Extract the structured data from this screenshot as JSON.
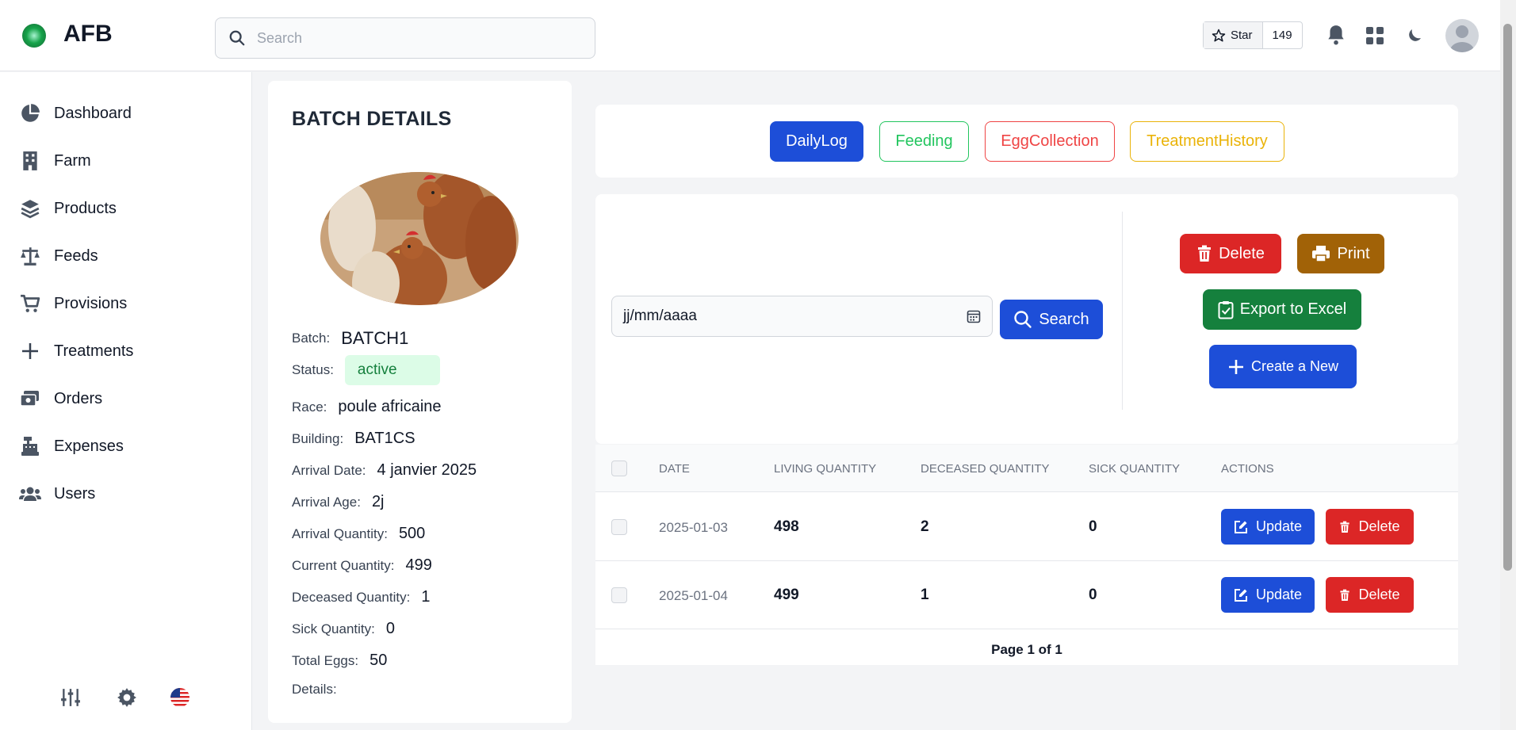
{
  "header": {
    "brand": "AFB",
    "search_placeholder": "Search",
    "star_label": "Star",
    "star_count": "149"
  },
  "sidebar": {
    "items": [
      {
        "label": "Dashboard",
        "icon": "pie-chart-icon"
      },
      {
        "label": "Farm",
        "icon": "building-icon"
      },
      {
        "label": "Products",
        "icon": "layers-icon"
      },
      {
        "label": "Feeds",
        "icon": "scale-icon"
      },
      {
        "label": "Provisions",
        "icon": "cart-icon"
      },
      {
        "label": "Treatments",
        "icon": "plus-icon"
      },
      {
        "label": "Orders",
        "icon": "wallet-icon"
      },
      {
        "label": "Expenses",
        "icon": "cash-register-icon"
      },
      {
        "label": "Users",
        "icon": "users-icon"
      }
    ]
  },
  "batch": {
    "title": "BATCH DETAILS",
    "batch_label": "Batch:",
    "batch_value": "BATCH1",
    "status_label": "Status:",
    "status_value": "active",
    "race_label": "Race:",
    "race_value": "poule africaine",
    "building_label": "Building:",
    "building_value": "BAT1CS",
    "arrival_date_label": "Arrival Date:",
    "arrival_date_value": "4 janvier 2025",
    "arrival_age_label": "Arrival Age:",
    "arrival_age_value": "2j",
    "arrival_qty_label": "Arrival Quantity:",
    "arrival_qty_value": "500",
    "current_qty_label": "Current Quantity:",
    "current_qty_value": "499",
    "deceased_qty_label": "Deceased Quantity:",
    "deceased_qty_value": "1",
    "sick_qty_label": "Sick Quantity:",
    "sick_qty_value": "0",
    "total_eggs_label": "Total Eggs:",
    "total_eggs_value": "50",
    "details_label": "Details:"
  },
  "tabs": {
    "daily_log": "DailyLog",
    "feeding": "Feeding",
    "egg_collection": "EggCollection",
    "treatment_history": "TreatmentHistory"
  },
  "filter": {
    "date_placeholder": "jj/mm/aaaa",
    "search_label": "Search",
    "delete_label": "Delete",
    "print_label": "Print",
    "export_label": "Export to Excel",
    "create_label": "Create a New"
  },
  "table": {
    "columns": [
      "DATE",
      "LIVING QUANTITY",
      "DECEASED QUANTITY",
      "SICK QUANTITY",
      "ACTIONS"
    ],
    "rows": [
      {
        "date": "2025-01-03",
        "living": "498",
        "deceased": "2",
        "sick": "0"
      },
      {
        "date": "2025-01-04",
        "living": "499",
        "deceased": "1",
        "sick": "0"
      }
    ],
    "update_label": "Update",
    "delete_label": "Delete",
    "pager": "Page 1 of 1"
  },
  "colors": {
    "primary": "#1d4ed8",
    "danger": "#dc2626",
    "success": "#15803d",
    "print": "#a16207",
    "feeding": "#22c55e",
    "egg": "#ef4444",
    "treatment": "#eab308"
  }
}
